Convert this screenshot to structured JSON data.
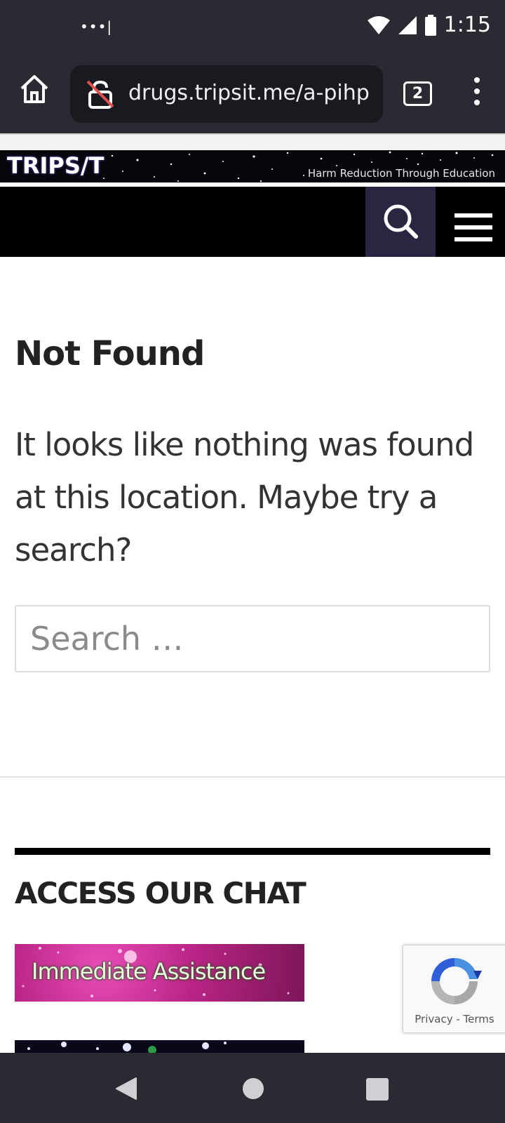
{
  "status_bar": {
    "dots": "•••|",
    "time": "1:15"
  },
  "browser": {
    "url": "drugs.tripsit.me/a-pihp",
    "tab_count": "2"
  },
  "site": {
    "logo": "TRIPS/T",
    "tagline": "Harm Reduction Through Education"
  },
  "content": {
    "title": "Not Found",
    "message": "It looks like nothing was found at this location. Maybe try a search?",
    "search_placeholder": "Search …"
  },
  "widget": {
    "title": "ACCESS OUR CHAT",
    "assist_label": "Immediate Assistance"
  },
  "recaptcha": {
    "privacy": "Privacy",
    "separator": " - ",
    "terms": "Terms"
  },
  "colors": {
    "chrome_bg": "#2a2a33",
    "nav_bg": "#000000",
    "search_tile_bg": "#2b2541",
    "assist_bg": "#b92485"
  }
}
